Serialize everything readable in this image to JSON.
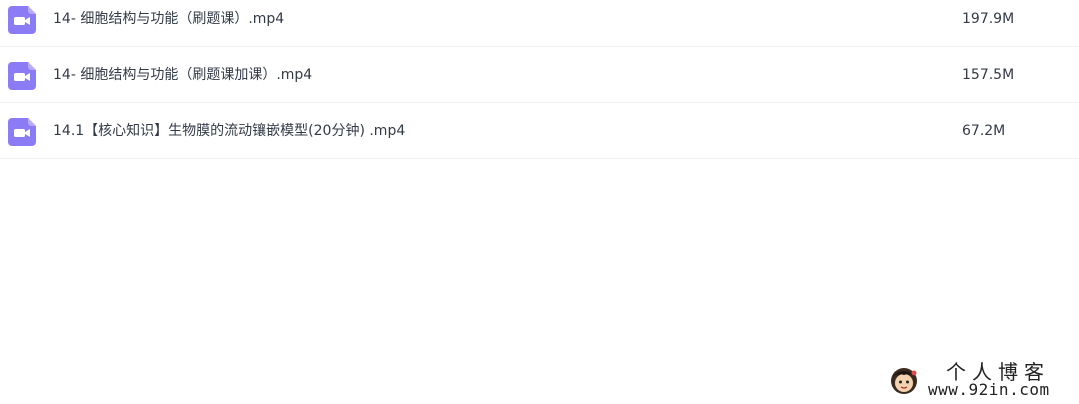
{
  "files": [
    {
      "name": "14- 细胞结构与功能（刷题课）.mp4",
      "size": "197.9M",
      "icon": "video-file-icon"
    },
    {
      "name": "14- 细胞结构与功能（刷题课加课）.mp4",
      "size": "157.5M",
      "icon": "video-file-icon"
    },
    {
      "name": "14.1【核心知识】生物膜的流动镶嵌模型(20分钟) .mp4",
      "size": "67.2M",
      "icon": "video-file-icon"
    }
  ],
  "watermark": {
    "title": "个人博客",
    "url": "www.92in.com"
  },
  "colors": {
    "icon_purple": "#8b7cf6",
    "text": "#333a47",
    "divider": "#f0f0f3"
  }
}
